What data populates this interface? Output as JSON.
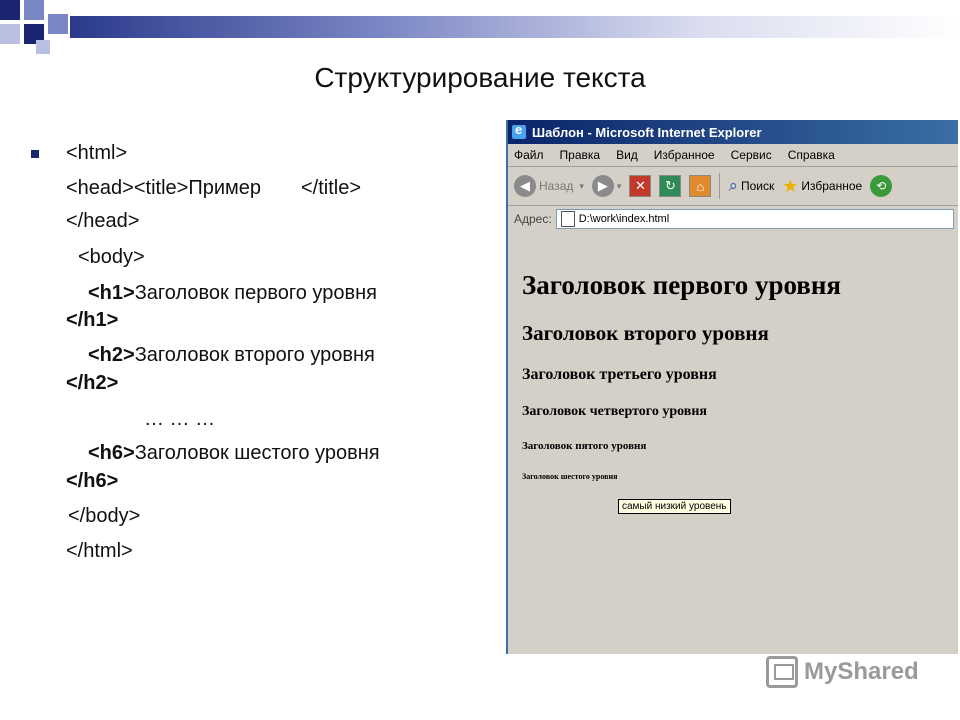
{
  "slide": {
    "title": "Структурирование текста",
    "code_lines": {
      "html_open": "<html>",
      "head_title": "<head><title>Пример",
      "title_close": "</title>",
      "head_close": "</head>",
      "body_open": "<body>",
      "h1_tag": "<h1>",
      "h1_text": "Заголовок первого уровня",
      "h1_close": "</h1>",
      "h2_tag": "<h2>",
      "h2_text": "Заголовок второго уровня",
      "h2_close": "</h2>",
      "ellipsis": "… … …",
      "h6_tag": "<h6>",
      "h6_text": "Заголовок шестого уровня",
      "h6_close": "</h6>",
      "body_close": "</body>",
      "html_close": "</html>"
    }
  },
  "browser": {
    "window_title": "Шаблон - Microsoft Internet Explorer",
    "menu": [
      "Файл",
      "Правка",
      "Вид",
      "Избранное",
      "Сервис",
      "Справка"
    ],
    "toolbar": {
      "back_label": "Назад",
      "search_label": "Поиск",
      "favorites_label": "Избранное"
    },
    "address_label": "Адрес:",
    "address_value": "D:\\work\\index.html",
    "page": {
      "h1": "Заголовок первого уровня",
      "h2": "Заголовок второго уровня",
      "h3": "Заголовок третьего уровня",
      "h4": "Заголовок четвертого уровня",
      "h5": "Заголовок пятого уровня",
      "h6": "Заголовок шестого уровня"
    },
    "tooltip": "самый низкий уровень"
  },
  "watermark": "MyShared",
  "colors": {
    "accent": "#1a2470",
    "titlebar": "#0a246a",
    "window_bg": "#d4d0c8",
    "tooltip_bg": "#ffffe1"
  }
}
